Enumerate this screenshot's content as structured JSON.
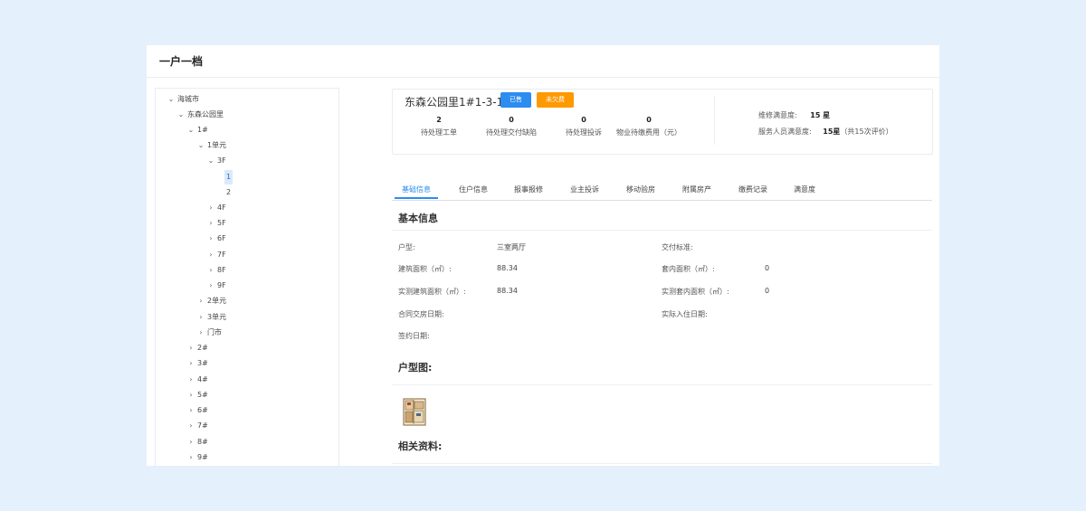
{
  "app": {
    "title": "一户一档"
  },
  "tree": {
    "items": [
      {
        "label": "海城市",
        "arrow": "⌄"
      },
      {
        "label": "东森公园里",
        "arrow": "⌄"
      },
      {
        "label": "1#",
        "arrow": "⌄"
      },
      {
        "label": "1单元",
        "arrow": "⌄"
      },
      {
        "label": "3F",
        "arrow": "⌄"
      },
      {
        "label": "1",
        "arrow": ""
      },
      {
        "label": "2",
        "arrow": ""
      },
      {
        "label": "4F",
        "arrow": "›"
      },
      {
        "label": "5F",
        "arrow": "›"
      },
      {
        "label": "6F",
        "arrow": "›"
      },
      {
        "label": "7F",
        "arrow": "›"
      },
      {
        "label": "8F",
        "arrow": "›"
      },
      {
        "label": "9F",
        "arrow": "›"
      },
      {
        "label": "2单元",
        "arrow": "›"
      },
      {
        "label": "3单元",
        "arrow": "›"
      },
      {
        "label": "门市",
        "arrow": "›"
      },
      {
        "label": "2#",
        "arrow": "›"
      },
      {
        "label": "3#",
        "arrow": "›"
      },
      {
        "label": "4#",
        "arrow": "›"
      },
      {
        "label": "5#",
        "arrow": "›"
      },
      {
        "label": "6#",
        "arrow": "›"
      },
      {
        "label": "7#",
        "arrow": "›"
      },
      {
        "label": "8#",
        "arrow": "›"
      },
      {
        "label": "9#",
        "arrow": "›"
      }
    ]
  },
  "summary": {
    "house_name": "东森公园里1#1-3-1",
    "badge_sold": "已售",
    "badge_fee": "未欠费",
    "stats": [
      {
        "value": "2",
        "label": "待处理工单"
      },
      {
        "value": "0",
        "label": "待处理交付缺陷"
      },
      {
        "value": "0",
        "label": "待处理投诉"
      },
      {
        "value": "0",
        "label": "物业待缴费用（元）"
      }
    ],
    "repair_rating_label": "维修满意度:",
    "repair_rating_value": "15 星",
    "staff_rating_label": "服务人员满意度:",
    "staff_rating_value": "15星",
    "staff_rating_note": "（共15次评价）"
  },
  "tabs": [
    "基础信息",
    "住户信息",
    "报事报修",
    "业主投诉",
    "移动验房",
    "附属房产",
    "缴费记录",
    "满意度"
  ],
  "basic": {
    "section_title": "基本信息",
    "fields": {
      "house_type_label": "户型:",
      "house_type_value": "三室两厅",
      "delivery_std_label": "交付标准:",
      "build_area_label": "建筑面积（㎡）:",
      "build_area_value": "88.34",
      "inner_area_label": "套内面积（㎡）:",
      "inner_area_value": "0",
      "measured_build_label": "实测建筑面积（㎡）:",
      "measured_build_value": "88.34",
      "measured_inner_label": "实测套内面积（㎡）:",
      "measured_inner_value": "0",
      "contract_date_label": "合同交房日期:",
      "move_in_label": "实际入住日期:",
      "sign_date_label": "签约日期:"
    },
    "floorplan_title": "户型图:",
    "docs_title": "相关资料:"
  }
}
